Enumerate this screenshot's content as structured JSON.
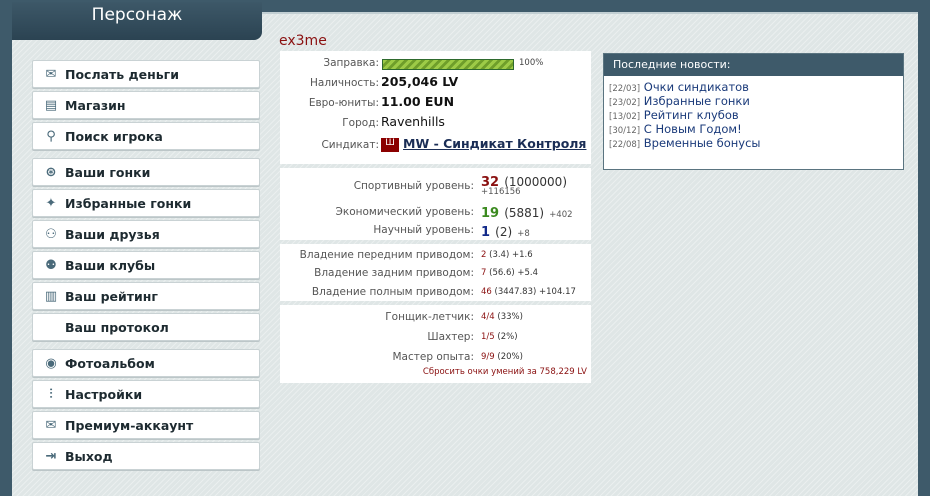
{
  "header": {
    "title": "Персонаж"
  },
  "player": {
    "name": "ex3me"
  },
  "menu": {
    "groups": [
      [
        {
          "label": "Послать деньги",
          "icon": "money-icon"
        },
        {
          "label": "Магазин",
          "icon": "shop-icon"
        },
        {
          "label": "Поиск игрока",
          "icon": "search-icon"
        }
      ],
      [
        {
          "label": "Ваши гонки",
          "icon": "steering-wheel-icon"
        },
        {
          "label": "Избранные гонки",
          "icon": "star-icon"
        },
        {
          "label": "Ваши друзья",
          "icon": "friends-icon"
        },
        {
          "label": "Ваши клубы",
          "icon": "clubs-icon"
        },
        {
          "label": "Ваш рейтинг",
          "icon": "rating-icon"
        },
        {
          "label": "Ваш протокол",
          "icon": ""
        }
      ],
      [
        {
          "label": "Фотоальбом",
          "icon": "camera-icon"
        },
        {
          "label": "Настройки",
          "icon": "settings-icon"
        },
        {
          "label": "Премиум-аккаунт",
          "icon": "premium-icon"
        },
        {
          "label": "Выход",
          "icon": "exit-icon"
        }
      ]
    ]
  },
  "stats": {
    "fuel_label": "Заправка:",
    "fuel_percent": 100,
    "fuel_text": "100%",
    "cash_label": "Наличность:",
    "cash_value": "205,046 LV",
    "euro_label": "Евро-юниты:",
    "euro_value": "11.00 EUN",
    "city_label": "Город:",
    "city_value": "Ravenhills",
    "syndicate_label": "Синдикат:",
    "syndicate_value": "MW - Синдикат Контроля"
  },
  "levels": {
    "sport_label": "Спортивный уровень:",
    "sport_level": "32",
    "sport_points": "(1000000)",
    "sport_gain": "+116156",
    "econ_label": "Экономический уровень:",
    "econ_level": "19",
    "econ_points": "(5881)",
    "econ_gain": "+402",
    "sci_label": "Научный уровень:",
    "sci_level": "1",
    "sci_points": "(2)",
    "sci_gain": "+8"
  },
  "drives": {
    "front_label": "Владение передним приводом:",
    "front_level": "2",
    "front_points": "(3.4)",
    "front_gain": "+1.6",
    "rear_label": "Владение задним приводом:",
    "rear_level": "7",
    "rear_points": "(56.6)",
    "rear_gain": "+5.4",
    "full_label": "Владение полным приводом:",
    "full_level": "46",
    "full_points": "(3447.83)",
    "full_gain": "+104.17"
  },
  "skills": {
    "pilot_label": "Гонщик-летчик:",
    "pilot_value": "4/4",
    "pilot_pct": "(33%)",
    "miner_label": "Шахтер:",
    "miner_value": "1/5",
    "miner_pct": "(2%)",
    "master_label": "Мастер опыта:",
    "master_value": "9/9",
    "master_pct": "(20%)",
    "reset_link": "Сбросить очки умений за 758,229 LV"
  },
  "news": {
    "title": "Последние новости:",
    "items": [
      {
        "date": "[22/03]",
        "title": "Очки синдикатов"
      },
      {
        "date": "[23/02]",
        "title": "Избранные гонки"
      },
      {
        "date": "[13/02]",
        "title": "Рейтинг клубов"
      },
      {
        "date": "[30/12]",
        "title": "С Новым Годом!"
      },
      {
        "date": "[22/08]",
        "title": "Временные бонусы"
      }
    ]
  },
  "colors": {
    "accent": "#3e5a6a",
    "red": "#8a1010",
    "green": "#3b8a1f",
    "blue": "#122a8a"
  }
}
